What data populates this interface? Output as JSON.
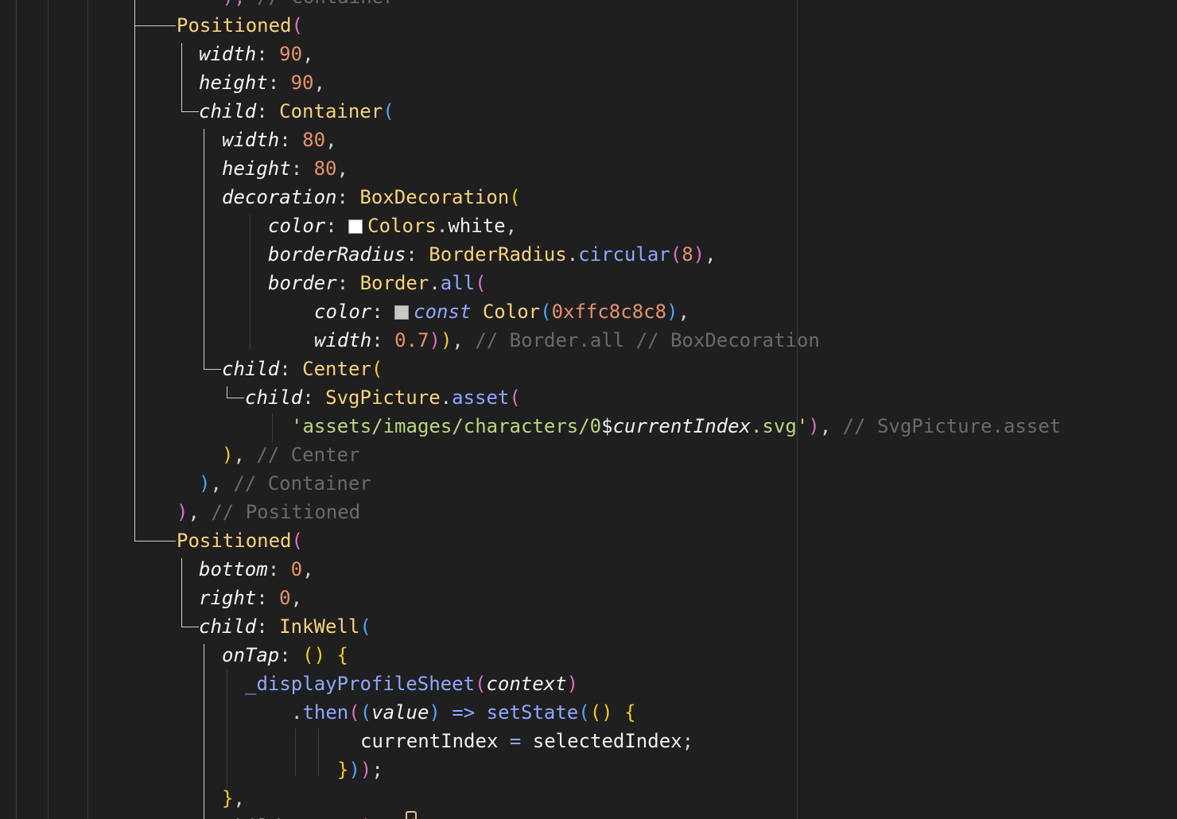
{
  "colors": {
    "background": "#1f1f1f",
    "class": "#f9d27b",
    "param": "#f5f5f5",
    "number": "#e8916b",
    "punct": "#d4d4d4",
    "method": "#8fa7ff",
    "comment": "#6a6a6a",
    "string": "#b9d77f",
    "keyword": "#8fa7ff",
    "bracket_pink": "#de6fc2",
    "bracket_blue": "#4fa6f0",
    "bracket_yellow": "#f2c82e",
    "plain": "#f0f0f0"
  },
  "lines": [
    [
      {
        "t": "    ",
        "c": "punct"
      },
      {
        "t": "), ",
        "c": "bracket_pink"
      },
      {
        "t": "// Container",
        "c": "comment"
      }
    ],
    [
      {
        "t": "Positioned",
        "c": "class"
      },
      {
        "t": "(",
        "c": "bracket_pink"
      }
    ],
    [
      {
        "t": "width",
        "c": "param",
        "i": true
      },
      {
        "t": ": ",
        "c": "punct"
      },
      {
        "t": "90",
        "c": "number"
      },
      {
        "t": ",",
        "c": "punct"
      }
    ],
    [
      {
        "t": "height",
        "c": "param",
        "i": true
      },
      {
        "t": ": ",
        "c": "punct"
      },
      {
        "t": "90",
        "c": "number"
      },
      {
        "t": ",",
        "c": "punct"
      }
    ],
    [
      {
        "t": "child",
        "c": "param",
        "i": true
      },
      {
        "t": ": ",
        "c": "punct"
      },
      {
        "t": "Container",
        "c": "class"
      },
      {
        "t": "(",
        "c": "bracket_blue"
      }
    ],
    [
      {
        "t": "width",
        "c": "param",
        "i": true
      },
      {
        "t": ": ",
        "c": "punct"
      },
      {
        "t": "80",
        "c": "number"
      },
      {
        "t": ",",
        "c": "punct"
      }
    ],
    [
      {
        "t": "height",
        "c": "param",
        "i": true
      },
      {
        "t": ": ",
        "c": "punct"
      },
      {
        "t": "80",
        "c": "number"
      },
      {
        "t": ",",
        "c": "punct"
      }
    ],
    [
      {
        "t": "decoration",
        "c": "param",
        "i": true
      },
      {
        "t": ": ",
        "c": "punct"
      },
      {
        "t": "BoxDecoration",
        "c": "class"
      },
      {
        "t": "(",
        "c": "bracket_yellow"
      }
    ],
    [
      {
        "t": "color",
        "c": "param",
        "i": true
      },
      {
        "t": ": ",
        "c": "punct"
      },
      {
        "swatch": "#ffffff"
      },
      {
        "t": "Colors",
        "c": "class"
      },
      {
        "t": ".",
        "c": "punct"
      },
      {
        "t": "white",
        "c": "plain"
      },
      {
        "t": ",",
        "c": "punct"
      }
    ],
    [
      {
        "t": "borderRadius",
        "c": "param",
        "i": true
      },
      {
        "t": ": ",
        "c": "punct"
      },
      {
        "t": "BorderRadius",
        "c": "class"
      },
      {
        "t": ".",
        "c": "punct"
      },
      {
        "t": "circular",
        "c": "method"
      },
      {
        "t": "(",
        "c": "bracket_pink"
      },
      {
        "t": "8",
        "c": "number"
      },
      {
        "t": ")",
        "c": "bracket_pink"
      },
      {
        "t": ",",
        "c": "punct"
      }
    ],
    [
      {
        "t": "border",
        "c": "param",
        "i": true
      },
      {
        "t": ": ",
        "c": "punct"
      },
      {
        "t": "Border",
        "c": "class"
      },
      {
        "t": ".",
        "c": "punct"
      },
      {
        "t": "all",
        "c": "method"
      },
      {
        "t": "(",
        "c": "bracket_pink"
      }
    ],
    [
      {
        "t": "color",
        "c": "param",
        "i": true
      },
      {
        "t": ": ",
        "c": "punct"
      },
      {
        "swatch": "#c8c8c8"
      },
      {
        "t": "const ",
        "c": "keyword",
        "i": true
      },
      {
        "t": "Color",
        "c": "class"
      },
      {
        "t": "(",
        "c": "bracket_blue"
      },
      {
        "t": "0xffc8c8c8",
        "c": "number"
      },
      {
        "t": ")",
        "c": "bracket_blue"
      },
      {
        "t": ",",
        "c": "punct"
      }
    ],
    [
      {
        "t": "width",
        "c": "param",
        "i": true
      },
      {
        "t": ": ",
        "c": "punct"
      },
      {
        "t": "0.7",
        "c": "number"
      },
      {
        "t": ")",
        "c": "bracket_pink"
      },
      {
        "t": ")",
        "c": "bracket_yellow"
      },
      {
        "t": ", ",
        "c": "punct"
      },
      {
        "t": "// Border.all // BoxDecoration",
        "c": "comment"
      }
    ],
    [
      {
        "t": "child",
        "c": "param",
        "i": true
      },
      {
        "t": ": ",
        "c": "punct"
      },
      {
        "t": "Center",
        "c": "class"
      },
      {
        "t": "(",
        "c": "bracket_yellow"
      }
    ],
    [
      {
        "t": "child",
        "c": "param",
        "i": true
      },
      {
        "t": ": ",
        "c": "punct"
      },
      {
        "t": "SvgPicture",
        "c": "class"
      },
      {
        "t": ".",
        "c": "punct"
      },
      {
        "t": "asset",
        "c": "method"
      },
      {
        "t": "(",
        "c": "bracket_pink"
      }
    ],
    [
      {
        "t": "'assets/images/characters/0",
        "c": "string"
      },
      {
        "t": "$",
        "c": "plain"
      },
      {
        "t": "currentIndex",
        "c": "plain",
        "i": true
      },
      {
        "t": ".svg'",
        "c": "string"
      },
      {
        "t": ")",
        "c": "bracket_pink"
      },
      {
        "t": ", ",
        "c": "punct"
      },
      {
        "t": "// SvgPicture.asset",
        "c": "comment"
      }
    ],
    [
      {
        "t": ")",
        "c": "bracket_yellow"
      },
      {
        "t": ", ",
        "c": "punct"
      },
      {
        "t": "// Center",
        "c": "comment"
      }
    ],
    [
      {
        "t": ")",
        "c": "bracket_blue"
      },
      {
        "t": ", ",
        "c": "punct"
      },
      {
        "t": "// Container",
        "c": "comment"
      }
    ],
    [
      {
        "t": ")",
        "c": "bracket_pink"
      },
      {
        "t": ", ",
        "c": "punct"
      },
      {
        "t": "// Positioned",
        "c": "comment"
      }
    ],
    [
      {
        "t": "Positioned",
        "c": "class"
      },
      {
        "t": "(",
        "c": "bracket_pink"
      }
    ],
    [
      {
        "t": "bottom",
        "c": "param",
        "i": true
      },
      {
        "t": ": ",
        "c": "punct"
      },
      {
        "t": "0",
        "c": "number"
      },
      {
        "t": ",",
        "c": "punct"
      }
    ],
    [
      {
        "t": "right",
        "c": "param",
        "i": true
      },
      {
        "t": ": ",
        "c": "punct"
      },
      {
        "t": "0",
        "c": "number"
      },
      {
        "t": ",",
        "c": "punct"
      }
    ],
    [
      {
        "t": "child",
        "c": "param",
        "i": true
      },
      {
        "t": ": ",
        "c": "punct"
      },
      {
        "t": "InkWell",
        "c": "class"
      },
      {
        "t": "(",
        "c": "bracket_blue"
      }
    ],
    [
      {
        "t": "onTap",
        "c": "param",
        "i": true
      },
      {
        "t": ": ",
        "c": "punct"
      },
      {
        "t": "() ",
        "c": "bracket_yellow"
      },
      {
        "t": "{",
        "c": "bracket_yellow"
      }
    ],
    [
      {
        "t": "_displayProfileSheet",
        "c": "method"
      },
      {
        "t": "(",
        "c": "bracket_pink"
      },
      {
        "t": "context",
        "c": "plain",
        "i": true
      },
      {
        "t": ")",
        "c": "bracket_pink"
      }
    ],
    [
      {
        "t": ".",
        "c": "punct"
      },
      {
        "t": "then",
        "c": "method"
      },
      {
        "t": "(",
        "c": "bracket_pink"
      },
      {
        "t": "(",
        "c": "bracket_blue"
      },
      {
        "t": "value",
        "c": "plain",
        "i": true
      },
      {
        "t": ")",
        "c": "bracket_blue"
      },
      {
        "t": " => ",
        "c": "keyword"
      },
      {
        "t": "setState",
        "c": "method"
      },
      {
        "t": "(",
        "c": "bracket_blue"
      },
      {
        "t": "() ",
        "c": "bracket_yellow"
      },
      {
        "t": "{",
        "c": "bracket_yellow"
      }
    ],
    [
      {
        "t": "currentIndex",
        "c": "plain"
      },
      {
        "t": " = ",
        "c": "keyword"
      },
      {
        "t": "selectedIndex",
        "c": "plain"
      },
      {
        "t": ";",
        "c": "punct"
      }
    ],
    [
      {
        "t": "}",
        "c": "bracket_yellow"
      },
      {
        "t": ")",
        "c": "bracket_blue"
      },
      {
        "t": ")",
        "c": "bracket_pink"
      },
      {
        "t": ";",
        "c": "punct"
      }
    ],
    [
      {
        "t": "}",
        "c": "bracket_yellow"
      },
      {
        "t": ",",
        "c": "punct"
      }
    ],
    [
      {
        "t": "child",
        "c": "param",
        "i": true
      },
      {
        "t": ": ",
        "c": "punct"
      },
      {
        "t": "Container",
        "c": "class"
      },
      {
        "t": "(",
        "c": "bracket_yellow"
      }
    ]
  ]
}
